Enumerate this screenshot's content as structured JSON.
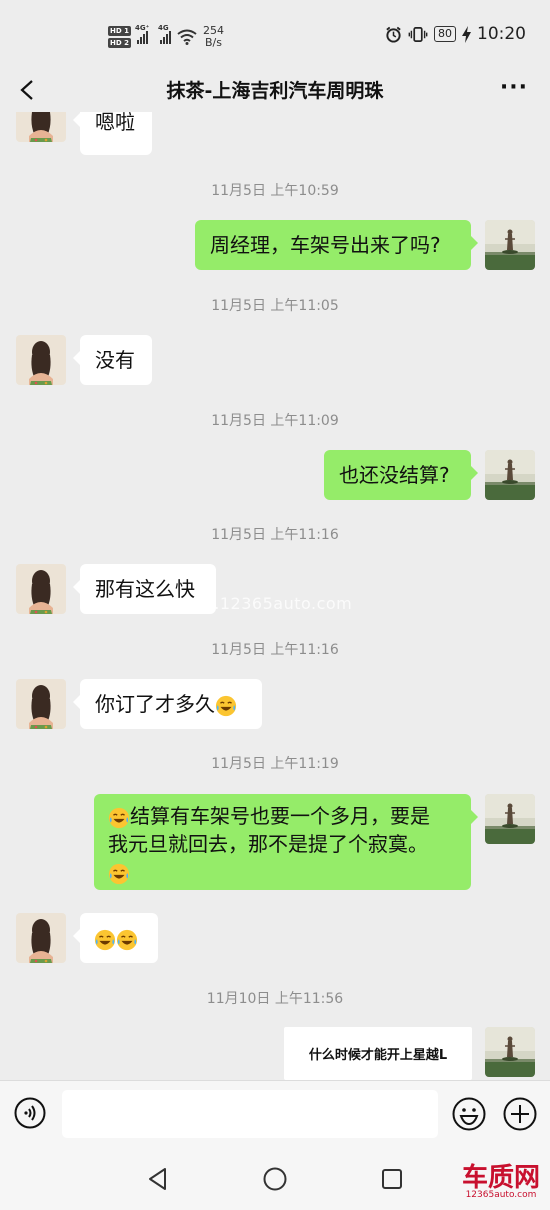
{
  "status_bar": {
    "hd1": "HD 1",
    "hd2": "HD 2",
    "net1": "4G⁺",
    "net2": "4G",
    "speed_value": "254",
    "speed_unit": "B/s",
    "battery": "80",
    "time": "10:20"
  },
  "header": {
    "title": "抹茶-上海吉利汽车周明珠"
  },
  "messages": {
    "m0": "嗯啦",
    "ts1": "11月5日 上午10:59",
    "m1": "周经理，车架号出来了吗?",
    "ts2": "11月5日 上午11:05",
    "m2": "没有",
    "ts3": "11月5日 上午11:09",
    "m3": "也还没结算?",
    "ts4": "11月5日 上午11:16",
    "m4": "那有这么快",
    "ts5": "11月5日 上午11:16",
    "m5": "你订了才多久",
    "ts6": "11月5日 上午11:19",
    "m6_line1": "结算有车架号也要一个多月，要是",
    "m6_line2": "我元旦就回去，那不是提了个寂寞。",
    "ts7": "11月10日 上午11:56",
    "m8_image_text": "什么时候才能开上星越L"
  },
  "watermark": "www.12365auto.com",
  "brand": {
    "name": "车质网",
    "url": "12365auto.com"
  },
  "colors": {
    "background": "#ededed",
    "outgoing_bubble": "#95ec69",
    "incoming_bubble": "#ffffff",
    "timestamp": "#8d8d8d"
  },
  "icons": {
    "emoji": "rolling-on-floor-laughing",
    "back": "chevron-left",
    "more": "ellipsis",
    "voice": "voice-input",
    "smile": "emoji-panel",
    "plus": "plus-circle"
  }
}
